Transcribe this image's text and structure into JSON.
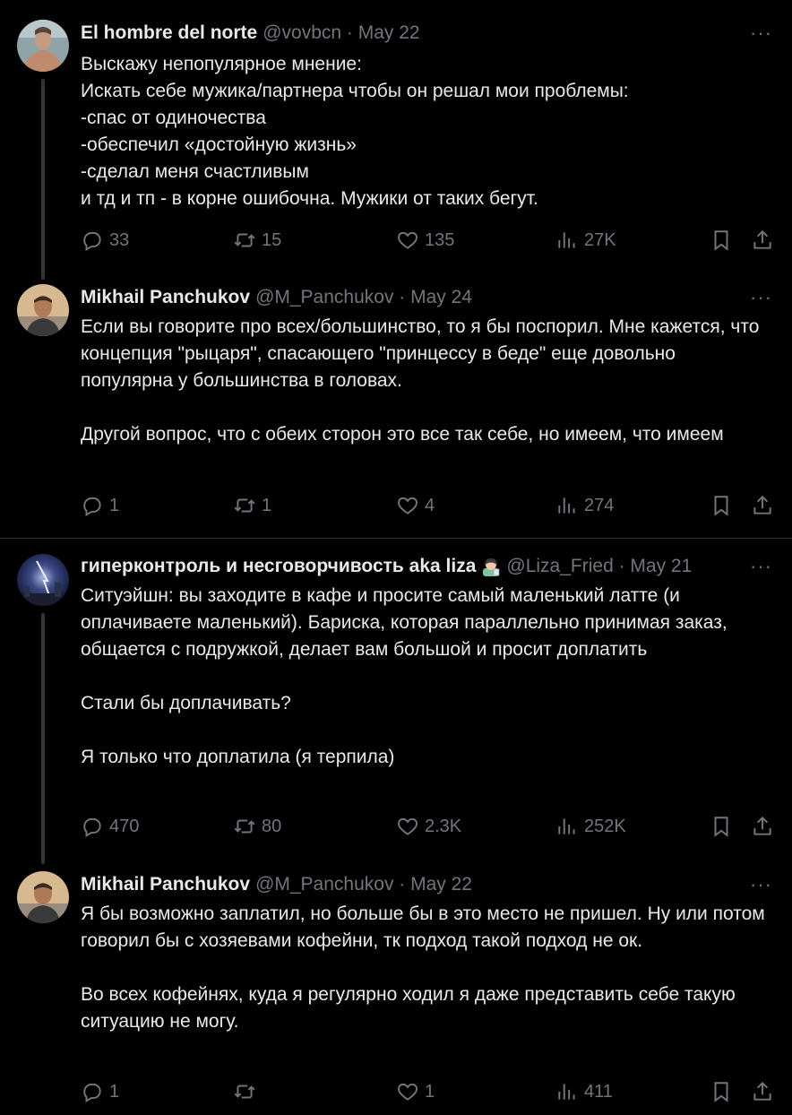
{
  "tweets": [
    {
      "name": "El hombre del norte",
      "handle": "@vovbcn · May 22",
      "text": "Выскажу непопулярное мнение:\nИскать себе мужика/партнера чтобы он решал мои проблемы:\n-спас от одиночества\n-обеспечил «достойную жизнь»\n-сделал меня счастливым\nи тд и тп - в корне ошибочна. Мужики от таких бегут.",
      "replies": "33",
      "retweets": "15",
      "likes": "135",
      "views": "27K"
    },
    {
      "name": "Mikhail Panchukov",
      "handle": "@M_Panchukov · May 24",
      "text": "Если вы говорите про всех/большинство, то я бы поспорил. Мне кажется, что концепция \"рыцаря\", спасающего \"принцессу в беде\" еще довольно популярна у большинства в головах.\n\nДругой вопрос, что с обеих сторон это все так себе, но имеем, что имеем",
      "replies": "1",
      "retweets": "1",
      "likes": "4",
      "views": "274"
    },
    {
      "name": "гиперконтроль и несговорчивость aka liza",
      "handle": "@Liza_Fried · May 21",
      "text": "Ситуэйшн: вы заходите в кафе и просите самый маленький латте (и оплачиваете маленький). Бариска, которая параллельно принимая заказ, общается с подружкой, делает вам большой и просит доплатить\n\nСтали бы доплачивать?\n\nЯ только что доплатила (я терпила)",
      "replies": "470",
      "retweets": "80",
      "likes": "2.3K",
      "views": "252K"
    },
    {
      "name": "Mikhail Panchukov",
      "handle": "@M_Panchukov · May 22",
      "text": "Я бы возможно заплатил, но больше бы в это место не пришел. Ну или потом говорил бы с хозяевами кофейни, тк подход такой подход не ок.\n\nВо всех кофейнях, куда я регулярно ходил я даже представить себе такую ситуацию не могу.",
      "replies": "1",
      "retweets": "",
      "likes": "1",
      "views": "411"
    }
  ],
  "more_label": "···",
  "colors": {
    "background": "#000000",
    "text": "#e7e9ea",
    "muted": "#71767b",
    "divider": "#2f3336"
  }
}
